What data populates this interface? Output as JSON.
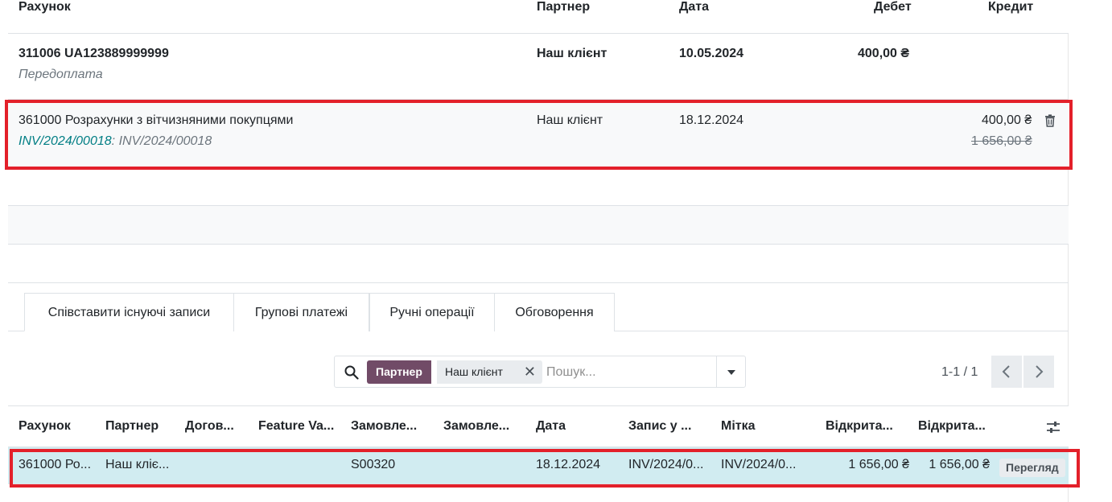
{
  "lines_table": {
    "headers": {
      "account": "Рахунок",
      "partner": "Партнер",
      "date": "Дата",
      "debit": "Дебет",
      "credit": "Кредит"
    },
    "rows": [
      {
        "account": "311006 UA123889999999",
        "label": "Передоплата",
        "partner": "Наш клієнт",
        "date": "10.05.2024",
        "debit": "400,00 ₴",
        "credit": ""
      },
      {
        "account": "361000 Розрахунки з вітчизняними покупцями",
        "ref_link": "INV/2024/00018",
        "ref_sep": ":",
        "ref_text": "INV/2024/00018",
        "partner": "Наш клієнт",
        "date": "18.12.2024",
        "debit": "",
        "credit": "400,00 ₴",
        "credit_original": "1 656,00 ₴",
        "delete_icon": "trash-icon"
      }
    ]
  },
  "tabs": [
    {
      "label": "Співставити існуючі записи",
      "active": true
    },
    {
      "label": "Групові платежі",
      "active": false
    },
    {
      "label": "Ручні операції",
      "active": false
    },
    {
      "label": "Обговорення",
      "active": false
    }
  ],
  "search": {
    "facet_label": "Партнер",
    "facet_value": "Наш клієнт",
    "placeholder": "Пошук...",
    "icon": "search-icon"
  },
  "pager": {
    "value": "1-1 / 1"
  },
  "match_table": {
    "headers": [
      "Рахунок",
      "Партнер",
      "Догов...",
      "Feature Va...",
      "Замовле...",
      "Замовле...",
      "Дата",
      "Запис у ...",
      "Мітка",
      "Відкрита...",
      "Відкрита..."
    ],
    "row": {
      "account": "361000 Ро...",
      "partner": "Наш кліє...",
      "contract": "",
      "feature": "",
      "order1": "S00320",
      "order2": "",
      "date": "18.12.2024",
      "entry": "INV/2024/0...",
      "label": "INV/2024/0...",
      "open1": "1 656,00 ₴",
      "open2": "1 656,00 ₴",
      "view_button": "Перегляд"
    }
  },
  "colors": {
    "highlight": "#e3202a",
    "facet": "#714b67",
    "link": "#017e84",
    "selected_row": "#d1ecf1"
  }
}
